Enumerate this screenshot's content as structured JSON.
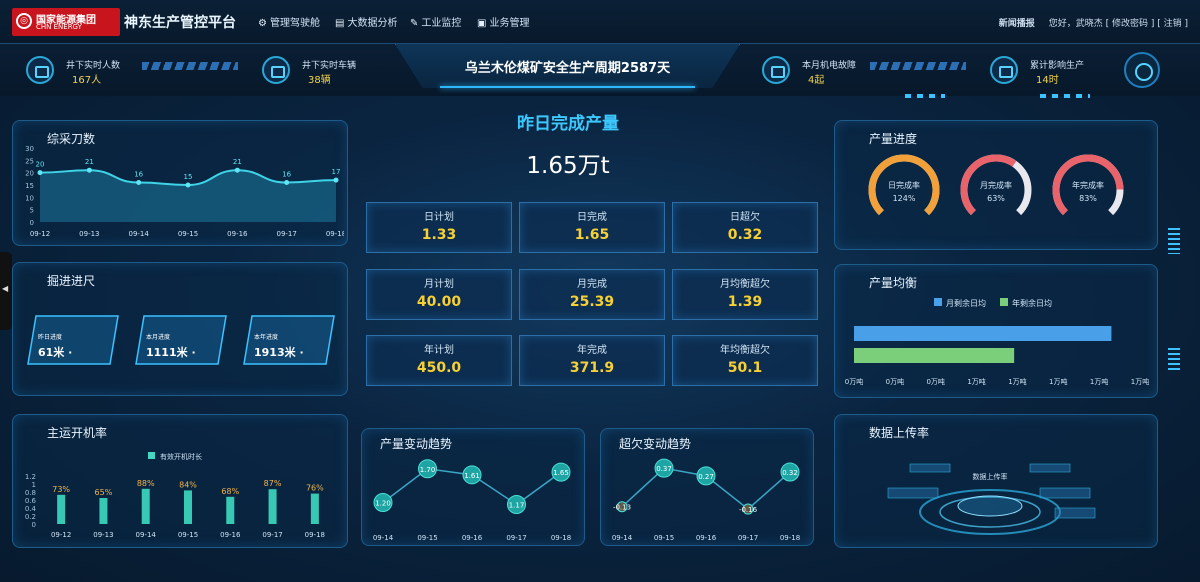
{
  "header": {
    "logo_cn": "国家能源集团",
    "logo_en": "CHN ENERGY",
    "title": "神东生产管控平台",
    "nav": [
      {
        "label": "管理驾驶舱",
        "icon": "gear-icon"
      },
      {
        "label": "大数据分析",
        "icon": "database-icon"
      },
      {
        "label": "工业监控",
        "icon": "wrench-icon"
      },
      {
        "label": "业务管理",
        "icon": "briefcase-icon"
      }
    ],
    "user_area": "新闻播报",
    "user_info": "您好，武晓杰 [ 修改密码 ] [ 注销 ]"
  },
  "stats": [
    {
      "label": "井下实时人数",
      "value": "167人"
    },
    {
      "label": "井下实时车辆",
      "value": "38辆"
    },
    {
      "label": "本月机电故障",
      "value": "4起"
    },
    {
      "label": "累计影响生产",
      "value": "14时"
    }
  ],
  "banner": {
    "text": "乌兰木伦煤矿安全生产周期2587天"
  },
  "yesterday": {
    "title": "昨日完成产量",
    "value": "1.65万t"
  },
  "production_boxes": [
    {
      "label": "日计划",
      "value": "1.33"
    },
    {
      "label": "日完成",
      "value": "1.65"
    },
    {
      "label": "日超欠",
      "value": "0.32"
    },
    {
      "label": "月计划",
      "value": "40.00"
    },
    {
      "label": "月完成",
      "value": "25.39"
    },
    {
      "label": "月均衡超欠",
      "value": "1.39"
    },
    {
      "label": "年计划",
      "value": "450.0"
    },
    {
      "label": "年完成",
      "value": "371.9"
    },
    {
      "label": "年均衡超欠",
      "value": "50.1"
    }
  ],
  "tunneling": {
    "title": "掘进进尺",
    "items": [
      {
        "label": "昨日进度",
        "value": "61米 ·"
      },
      {
        "label": "本月进度",
        "value": "1111米 ·"
      },
      {
        "label": "本年进度",
        "value": "1913米 ·"
      }
    ]
  },
  "progress": {
    "title": "产量进度",
    "gauges": [
      {
        "label": "日完成率",
        "value": "124%",
        "fraction": 1.0,
        "color": "#f2a13a"
      },
      {
        "label": "月完成率",
        "value": "63%",
        "fraction": 0.63,
        "color": "#e8636a"
      },
      {
        "label": "年完成率",
        "value": "83%",
        "fraction": 0.83,
        "color": "#e8636a"
      }
    ]
  },
  "balance": {
    "title": "产量均衡",
    "legend": [
      "月剩余日均",
      "年剩余日均"
    ],
    "colors": [
      "#4aa0e8",
      "#7ccf7a"
    ],
    "fractions": [
      0.9,
      0.56
    ],
    "ticks": [
      "0万吨",
      "0万吨",
      "0万吨",
      "1万吨",
      "1万吨",
      "1万吨",
      "1万吨",
      "1万吨"
    ]
  },
  "upload": {
    "title": "数据上传率",
    "center_label": "数据上传率"
  },
  "chart_data": [
    {
      "type": "area",
      "title": "综采刀数",
      "categories": [
        "09-12",
        "09-13",
        "09-14",
        "09-15",
        "09-16",
        "09-17",
        "09-18"
      ],
      "values": [
        20,
        21,
        16,
        15,
        21,
        16,
        17
      ],
      "yticks": [
        "30",
        "25",
        "20",
        "15",
        "10",
        "5",
        "0"
      ],
      "ylim": [
        0,
        30
      ]
    },
    {
      "type": "bar",
      "title": "主运开机率",
      "legend": "有效开机时长",
      "categories": [
        "09-12",
        "09-13",
        "09-14",
        "09-15",
        "09-16",
        "09-17",
        "09-18"
      ],
      "values": [
        0.73,
        0.65,
        0.88,
        0.84,
        0.68,
        0.87,
        0.76
      ],
      "labels": [
        "73%",
        "65%",
        "88%",
        "84%",
        "68%",
        "87%",
        "76%"
      ],
      "yticks": [
        "1.2",
        "1",
        "0.8",
        "0.6",
        "0.4",
        "0.2",
        "0"
      ],
      "ylim": [
        0,
        1.2
      ]
    },
    {
      "type": "line",
      "title": "产量变动趋势",
      "categories": [
        "09-14",
        "09-15",
        "09-16",
        "09-17",
        "09-18"
      ],
      "values": [
        1.2,
        1.7,
        1.61,
        1.17,
        1.65
      ],
      "labels": [
        "1.20",
        "1.70",
        "1.61",
        "1.17",
        "1.65"
      ],
      "ylim": [
        1.0,
        1.8
      ]
    },
    {
      "type": "line",
      "title": "超欠变动趋势",
      "categories": [
        "09-14",
        "09-15",
        "09-16",
        "09-17",
        "09-18"
      ],
      "values": [
        -0.13,
        0.37,
        0.27,
        -0.16,
        0.32
      ],
      "labels": [
        "-0.13",
        "0.37",
        "0.27",
        "-0.16",
        "0.32"
      ],
      "ylim": [
        -0.25,
        0.45
      ]
    }
  ]
}
